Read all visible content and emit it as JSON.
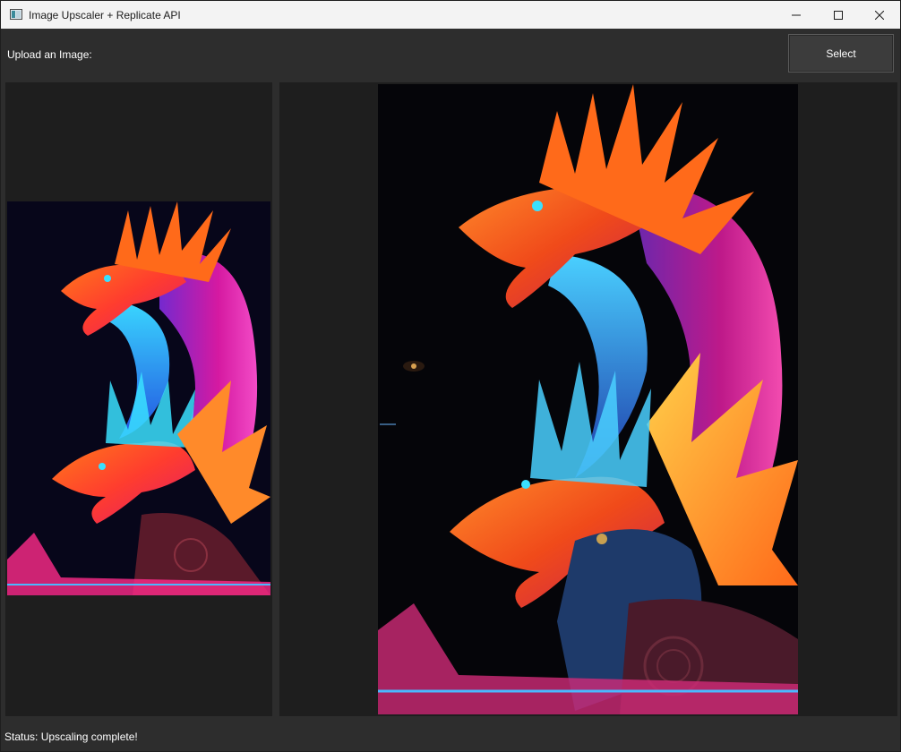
{
  "window": {
    "title": "Image Upscaler + Replicate API",
    "icon": "app-window-icon",
    "controls": [
      "minimize-icon",
      "maximize-icon",
      "close-icon"
    ]
  },
  "toolbar": {
    "upload_label": "Upload an Image:",
    "select_label": "Select"
  },
  "panels": {
    "original": {
      "image": "dragon-artwork-original"
    },
    "upscaled": {
      "image": "dragon-artwork-upscaled"
    }
  },
  "status": {
    "text": "Status: Upscaling complete!"
  },
  "colors": {
    "background": "#2d2d2d",
    "panel": "#1e1e1e",
    "button": "#3c3c3c",
    "titlebar": "#f3f3f3"
  }
}
